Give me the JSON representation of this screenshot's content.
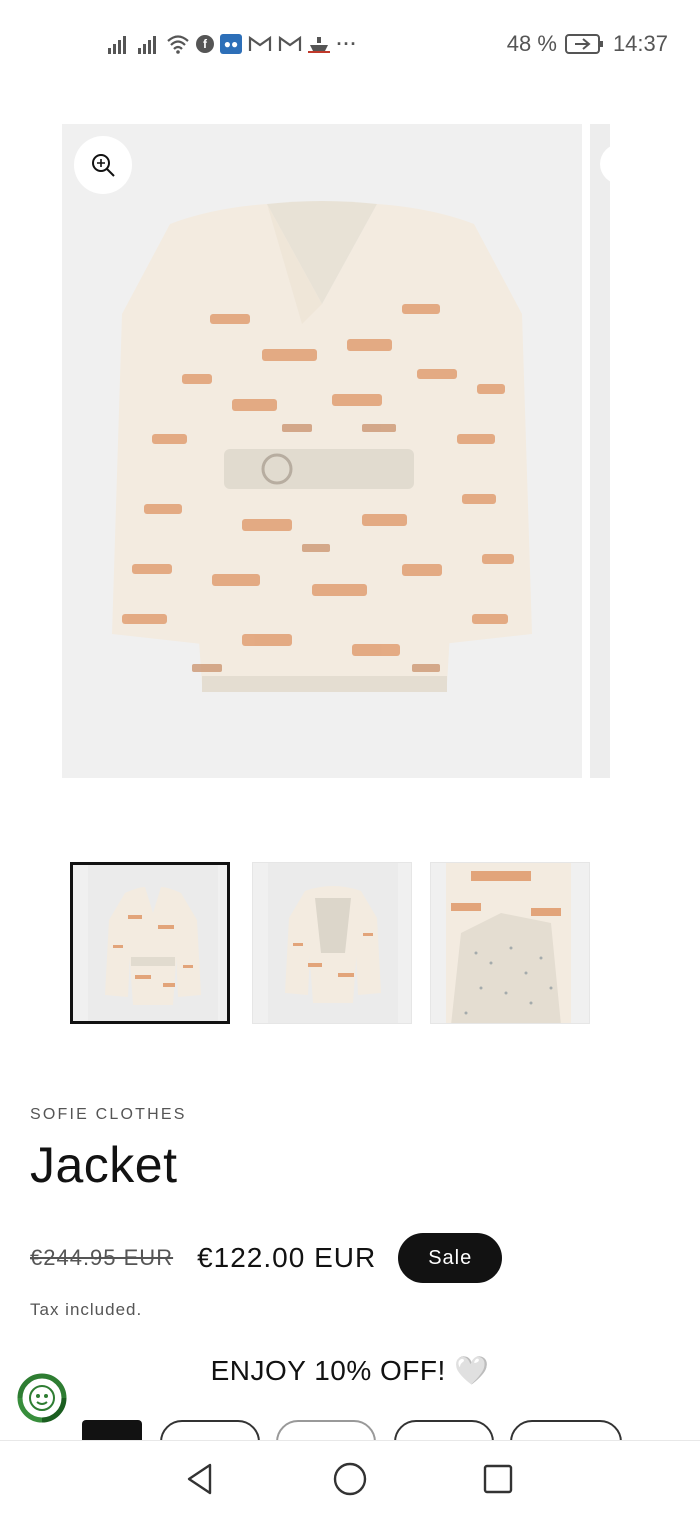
{
  "status_bar": {
    "battery": "48 %",
    "time": "14:37",
    "icons": [
      "signal-icon",
      "signal-icon",
      "wifi-icon",
      "facebook-icon",
      "wechat-icon",
      "gmail-icon",
      "gmail-icon",
      "ship-icon",
      "more-notifications-icon"
    ],
    "more": "···"
  },
  "product": {
    "vendor": "SOFIE CLOTHES",
    "title": "Jacket",
    "price_regular": "€244.95 EUR",
    "price_sale": "€122.00 EUR",
    "badge": "Sale",
    "tax_note": "Tax included."
  },
  "gallery": {
    "zoom_icon": "zoom-in-icon",
    "thumbnails": [
      "front",
      "back",
      "detail"
    ],
    "active_thumbnail": 0
  },
  "promo": {
    "text": "ENJOY 10% OFF!",
    "emoji": "🤍"
  },
  "colors": {
    "text": "#121212",
    "muted": "#555555",
    "badge_bg": "#121212",
    "image_bg": "#f0f0f0",
    "jacket_cream": "#f3ebe0",
    "jacket_orange": "#e2a47a",
    "eco_green": "#2e7d32"
  },
  "nav_bar": {
    "icons": [
      "back-icon",
      "home-icon",
      "recents-icon"
    ]
  }
}
